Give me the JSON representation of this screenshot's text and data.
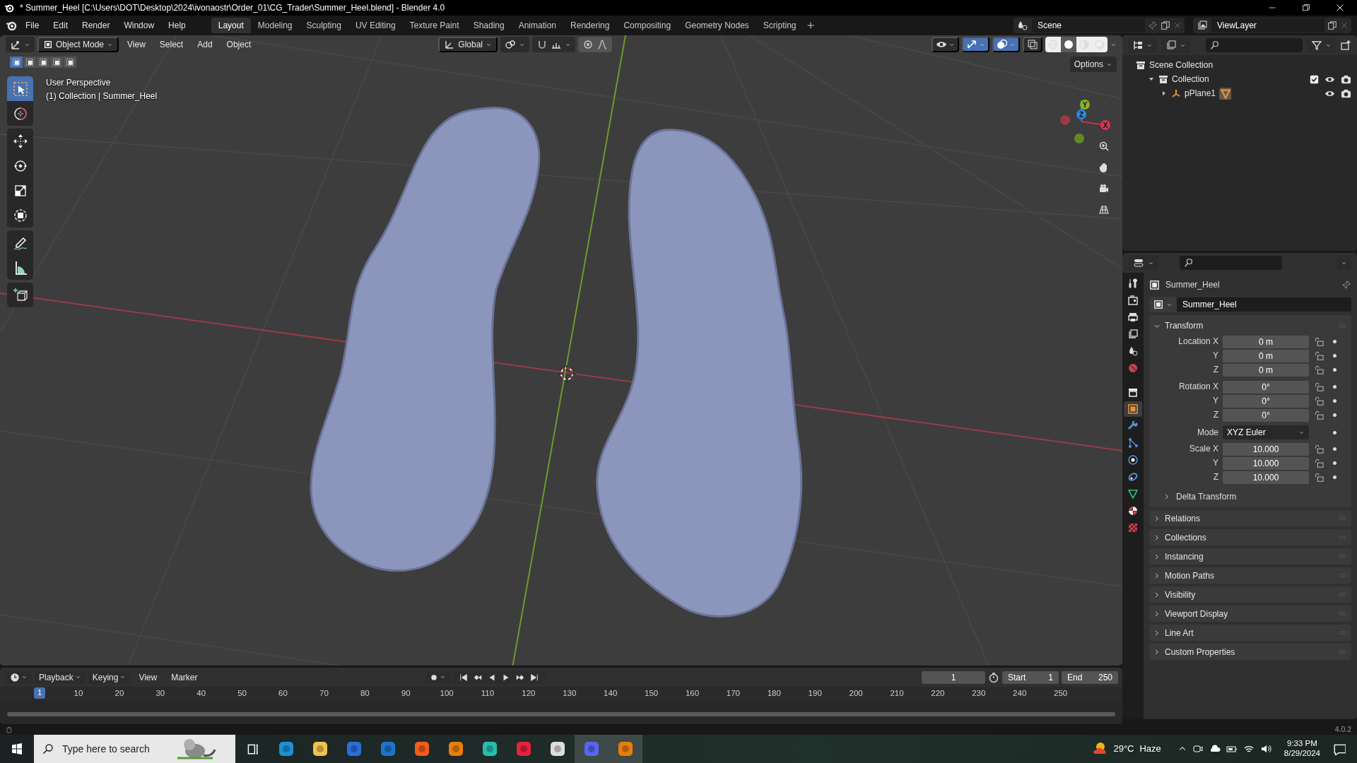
{
  "window": {
    "title": "* Summer_Heel [C:\\Users\\DOT\\Desktop\\2024\\ivonaostr\\Order_01\\CG_Trader\\Summer_Heel.blend] - Blender 4.0"
  },
  "menu": [
    "File",
    "Edit",
    "Render",
    "Window",
    "Help"
  ],
  "workspaces": [
    {
      "label": "Layout",
      "selected": true
    },
    {
      "label": "Modeling",
      "selected": false
    },
    {
      "label": "Sculpting",
      "selected": false
    },
    {
      "label": "UV Editing",
      "selected": false
    },
    {
      "label": "Texture Paint",
      "selected": false
    },
    {
      "label": "Shading",
      "selected": false
    },
    {
      "label": "Animation",
      "selected": false
    },
    {
      "label": "Rendering",
      "selected": false
    },
    {
      "label": "Compositing",
      "selected": false
    },
    {
      "label": "Geometry Nodes",
      "selected": false
    },
    {
      "label": "Scripting",
      "selected": false
    }
  ],
  "scene": "Scene",
  "view_layer": "ViewLayer",
  "viewport": {
    "mode": "Object Mode",
    "menus": [
      "View",
      "Select",
      "Add",
      "Object"
    ],
    "orientation": "Global",
    "options": "Options",
    "info": [
      "User Perspective",
      "(1) Collection | Summer_Heel"
    ],
    "select_modes": [
      {
        "selected": true
      },
      {
        "selected": false
      },
      {
        "selected": false
      },
      {
        "selected": false
      },
      {
        "selected": false
      }
    ],
    "tools": [
      {
        "kind": "select",
        "selected": true
      },
      {
        "kind": "cursor",
        "selected": false
      },
      {
        "kind": "move",
        "selected": false
      },
      {
        "kind": "rotate",
        "selected": false
      },
      {
        "kind": "scale",
        "selected": false
      },
      {
        "kind": "transform",
        "selected": false
      },
      {
        "kind": "annotate",
        "selected": false
      },
      {
        "kind": "measure",
        "selected": false
      },
      {
        "kind": "add",
        "selected": false
      }
    ],
    "snap": {
      "on": false
    },
    "proportional_edit": {
      "on": true
    },
    "toggles": [
      {
        "kind": "visibility",
        "on": false
      },
      {
        "kind": "gizmo",
        "on": true
      },
      {
        "kind": "overlay",
        "on": true
      },
      {
        "kind": "xray",
        "on": false
      }
    ],
    "shading": [
      {
        "kind": "wireframe",
        "selected": false
      },
      {
        "kind": "solid",
        "selected": true
      },
      {
        "kind": "material",
        "selected": false
      },
      {
        "kind": "rendered",
        "selected": false
      }
    ],
    "gizmo_axes": [
      "X",
      "Y",
      "Z"
    ]
  },
  "outliner": {
    "items": [
      {
        "label": "Scene Collection",
        "kind": "scene",
        "children": [
          {
            "label": "Collection",
            "kind": "collection",
            "expanded": true,
            "checked": true,
            "children": [
              {
                "label": "pPlane1",
                "kind": "object",
                "expanded": false
              }
            ]
          }
        ]
      }
    ]
  },
  "properties": {
    "tabs": [
      {
        "kind": "tool",
        "selected": false
      },
      {
        "kind": "render",
        "selected": false
      },
      {
        "kind": "output",
        "selected": false
      },
      {
        "kind": "viewlayer",
        "selected": false
      },
      {
        "kind": "scene",
        "selected": false
      },
      {
        "kind": "world",
        "selected": false
      },
      {
        "kind": "collection",
        "selected": false
      },
      {
        "kind": "object",
        "selected": true
      },
      {
        "kind": "modifier",
        "selected": false
      },
      {
        "kind": "particles",
        "selected": false
      },
      {
        "kind": "physics",
        "selected": false
      },
      {
        "kind": "constraints",
        "selected": false
      },
      {
        "kind": "data",
        "selected": false
      },
      {
        "kind": "material",
        "selected": false
      },
      {
        "kind": "texture",
        "selected": false
      }
    ],
    "object_name": "Summer_Heel",
    "datablock": "Summer_Heel",
    "transform": {
      "label": "Transform",
      "expanded": true,
      "rows": [
        {
          "label": "Location X",
          "value": "0 m",
          "kind": "number"
        },
        {
          "label": "Y",
          "value": "0 m",
          "kind": "number"
        },
        {
          "label": "Z",
          "value": "0 m",
          "kind": "number"
        },
        {
          "label": "Rotation X",
          "value": "0°",
          "kind": "number"
        },
        {
          "label": "Y",
          "value": "0°",
          "kind": "number"
        },
        {
          "label": "Z",
          "value": "0°",
          "kind": "number"
        },
        {
          "label": "Mode",
          "value": "XYZ Euler",
          "kind": "dropdown"
        },
        {
          "label": "Scale X",
          "value": "10.000",
          "kind": "number"
        },
        {
          "label": "Y",
          "value": "10.000",
          "kind": "number"
        },
        {
          "label": "Z",
          "value": "10.000",
          "kind": "number"
        }
      ],
      "subpanel": {
        "label": "Delta Transform",
        "expanded": false
      }
    },
    "panels": [
      {
        "label": "Relations",
        "expanded": false
      },
      {
        "label": "Collections",
        "expanded": false
      },
      {
        "label": "Instancing",
        "expanded": false
      },
      {
        "label": "Motion Paths",
        "expanded": false
      },
      {
        "label": "Visibility",
        "expanded": false
      },
      {
        "label": "Viewport Display",
        "expanded": false
      },
      {
        "label": "Line Art",
        "expanded": false
      },
      {
        "label": "Custom Properties",
        "expanded": false
      }
    ]
  },
  "timeline": {
    "menus": [
      {
        "label": "Playback",
        "kind": "dropdown"
      },
      {
        "label": "Keying",
        "kind": "dropdown"
      },
      {
        "label": "View",
        "kind": "plain"
      },
      {
        "label": "Marker",
        "kind": "plain"
      }
    ],
    "current_frame": "1",
    "start_label": "Start",
    "start": "1",
    "end_label": "End",
    "end": "250",
    "playhead": "1",
    "ruler": [
      "10",
      "20",
      "30",
      "40",
      "50",
      "60",
      "70",
      "80",
      "90",
      "100",
      "110",
      "120",
      "130",
      "140",
      "150",
      "160",
      "170",
      "180",
      "190",
      "200",
      "210",
      "220",
      "230",
      "240",
      "250"
    ]
  },
  "status": {
    "version": "4.0.2"
  },
  "taskbar": {
    "search_placeholder": "Type here to search",
    "apps": [
      {
        "color": "#1f8fd6",
        "active": false
      },
      {
        "color": "#f2c14e",
        "active": false
      },
      {
        "color": "#2a6fd6",
        "active": false
      },
      {
        "color": "#1d74c9",
        "active": false
      },
      {
        "color": "#f25c1c",
        "active": false
      },
      {
        "color": "#e87d0d",
        "active": false
      },
      {
        "color": "#2bbbad",
        "active": false
      },
      {
        "color": "#e6223c",
        "active": false
      },
      {
        "color": "#dddddd",
        "active": false
      },
      {
        "color": "#5865f2",
        "active": true
      },
      {
        "color": "#e87d0d",
        "active": true
      }
    ],
    "temperature": "29°C",
    "condition": "Haze",
    "time": "9:33 PM",
    "date": "8/29/2024"
  }
}
